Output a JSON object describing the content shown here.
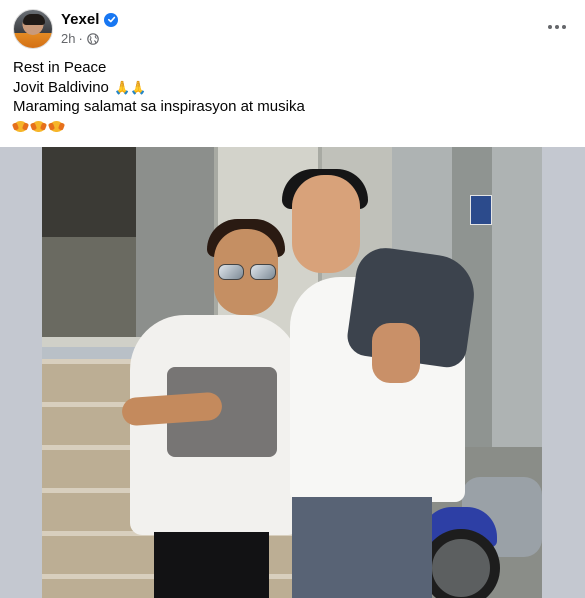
{
  "post": {
    "author_name": "Yexel",
    "timestamp": "2h",
    "visibility_separator": "·",
    "icons": {
      "verified": "verified-badge-icon",
      "visibility": "globe-icon",
      "more": "more-options-icon"
    },
    "caption": {
      "line1": "Rest in Peace",
      "line2": "Jovit Baldivino",
      "line2_emoji": "🙏🙏",
      "line3": "Maraming salamat sa inspirasyon at musika",
      "line4_emoji_count": 3,
      "line4_emoji_name": "disguised-pray-emoji"
    },
    "colors": {
      "name": "#050505",
      "meta": "#65676b",
      "verified": "#1877f2",
      "photo_letterbox": "#c4c8d0"
    }
  }
}
